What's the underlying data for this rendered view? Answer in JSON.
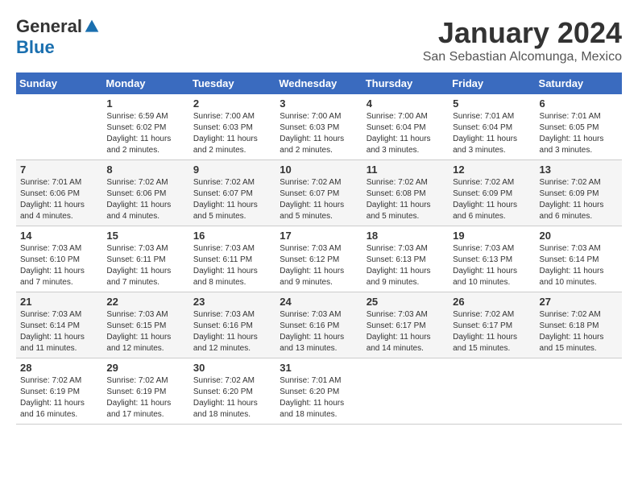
{
  "header": {
    "logo_general": "General",
    "logo_blue": "Blue",
    "month_title": "January 2024",
    "location": "San Sebastian Alcomunga, Mexico"
  },
  "days_of_week": [
    "Sunday",
    "Monday",
    "Tuesday",
    "Wednesday",
    "Thursday",
    "Friday",
    "Saturday"
  ],
  "weeks": [
    [
      {
        "day": "",
        "info": ""
      },
      {
        "day": "1",
        "info": "Sunrise: 6:59 AM\nSunset: 6:02 PM\nDaylight: 11 hours\nand 2 minutes."
      },
      {
        "day": "2",
        "info": "Sunrise: 7:00 AM\nSunset: 6:03 PM\nDaylight: 11 hours\nand 2 minutes."
      },
      {
        "day": "3",
        "info": "Sunrise: 7:00 AM\nSunset: 6:03 PM\nDaylight: 11 hours\nand 2 minutes."
      },
      {
        "day": "4",
        "info": "Sunrise: 7:00 AM\nSunset: 6:04 PM\nDaylight: 11 hours\nand 3 minutes."
      },
      {
        "day": "5",
        "info": "Sunrise: 7:01 AM\nSunset: 6:04 PM\nDaylight: 11 hours\nand 3 minutes."
      },
      {
        "day": "6",
        "info": "Sunrise: 7:01 AM\nSunset: 6:05 PM\nDaylight: 11 hours\nand 3 minutes."
      }
    ],
    [
      {
        "day": "7",
        "info": "Sunrise: 7:01 AM\nSunset: 6:06 PM\nDaylight: 11 hours\nand 4 minutes."
      },
      {
        "day": "8",
        "info": "Sunrise: 7:02 AM\nSunset: 6:06 PM\nDaylight: 11 hours\nand 4 minutes."
      },
      {
        "day": "9",
        "info": "Sunrise: 7:02 AM\nSunset: 6:07 PM\nDaylight: 11 hours\nand 5 minutes."
      },
      {
        "day": "10",
        "info": "Sunrise: 7:02 AM\nSunset: 6:07 PM\nDaylight: 11 hours\nand 5 minutes."
      },
      {
        "day": "11",
        "info": "Sunrise: 7:02 AM\nSunset: 6:08 PM\nDaylight: 11 hours\nand 5 minutes."
      },
      {
        "day": "12",
        "info": "Sunrise: 7:02 AM\nSunset: 6:09 PM\nDaylight: 11 hours\nand 6 minutes."
      },
      {
        "day": "13",
        "info": "Sunrise: 7:02 AM\nSunset: 6:09 PM\nDaylight: 11 hours\nand 6 minutes."
      }
    ],
    [
      {
        "day": "14",
        "info": "Sunrise: 7:03 AM\nSunset: 6:10 PM\nDaylight: 11 hours\nand 7 minutes."
      },
      {
        "day": "15",
        "info": "Sunrise: 7:03 AM\nSunset: 6:11 PM\nDaylight: 11 hours\nand 7 minutes."
      },
      {
        "day": "16",
        "info": "Sunrise: 7:03 AM\nSunset: 6:11 PM\nDaylight: 11 hours\nand 8 minutes."
      },
      {
        "day": "17",
        "info": "Sunrise: 7:03 AM\nSunset: 6:12 PM\nDaylight: 11 hours\nand 9 minutes."
      },
      {
        "day": "18",
        "info": "Sunrise: 7:03 AM\nSunset: 6:13 PM\nDaylight: 11 hours\nand 9 minutes."
      },
      {
        "day": "19",
        "info": "Sunrise: 7:03 AM\nSunset: 6:13 PM\nDaylight: 11 hours\nand 10 minutes."
      },
      {
        "day": "20",
        "info": "Sunrise: 7:03 AM\nSunset: 6:14 PM\nDaylight: 11 hours\nand 10 minutes."
      }
    ],
    [
      {
        "day": "21",
        "info": "Sunrise: 7:03 AM\nSunset: 6:14 PM\nDaylight: 11 hours\nand 11 minutes."
      },
      {
        "day": "22",
        "info": "Sunrise: 7:03 AM\nSunset: 6:15 PM\nDaylight: 11 hours\nand 12 minutes."
      },
      {
        "day": "23",
        "info": "Sunrise: 7:03 AM\nSunset: 6:16 PM\nDaylight: 11 hours\nand 12 minutes."
      },
      {
        "day": "24",
        "info": "Sunrise: 7:03 AM\nSunset: 6:16 PM\nDaylight: 11 hours\nand 13 minutes."
      },
      {
        "day": "25",
        "info": "Sunrise: 7:03 AM\nSunset: 6:17 PM\nDaylight: 11 hours\nand 14 minutes."
      },
      {
        "day": "26",
        "info": "Sunrise: 7:02 AM\nSunset: 6:17 PM\nDaylight: 11 hours\nand 15 minutes."
      },
      {
        "day": "27",
        "info": "Sunrise: 7:02 AM\nSunset: 6:18 PM\nDaylight: 11 hours\nand 15 minutes."
      }
    ],
    [
      {
        "day": "28",
        "info": "Sunrise: 7:02 AM\nSunset: 6:19 PM\nDaylight: 11 hours\nand 16 minutes."
      },
      {
        "day": "29",
        "info": "Sunrise: 7:02 AM\nSunset: 6:19 PM\nDaylight: 11 hours\nand 17 minutes."
      },
      {
        "day": "30",
        "info": "Sunrise: 7:02 AM\nSunset: 6:20 PM\nDaylight: 11 hours\nand 18 minutes."
      },
      {
        "day": "31",
        "info": "Sunrise: 7:01 AM\nSunset: 6:20 PM\nDaylight: 11 hours\nand 18 minutes."
      },
      {
        "day": "",
        "info": ""
      },
      {
        "day": "",
        "info": ""
      },
      {
        "day": "",
        "info": ""
      }
    ]
  ]
}
